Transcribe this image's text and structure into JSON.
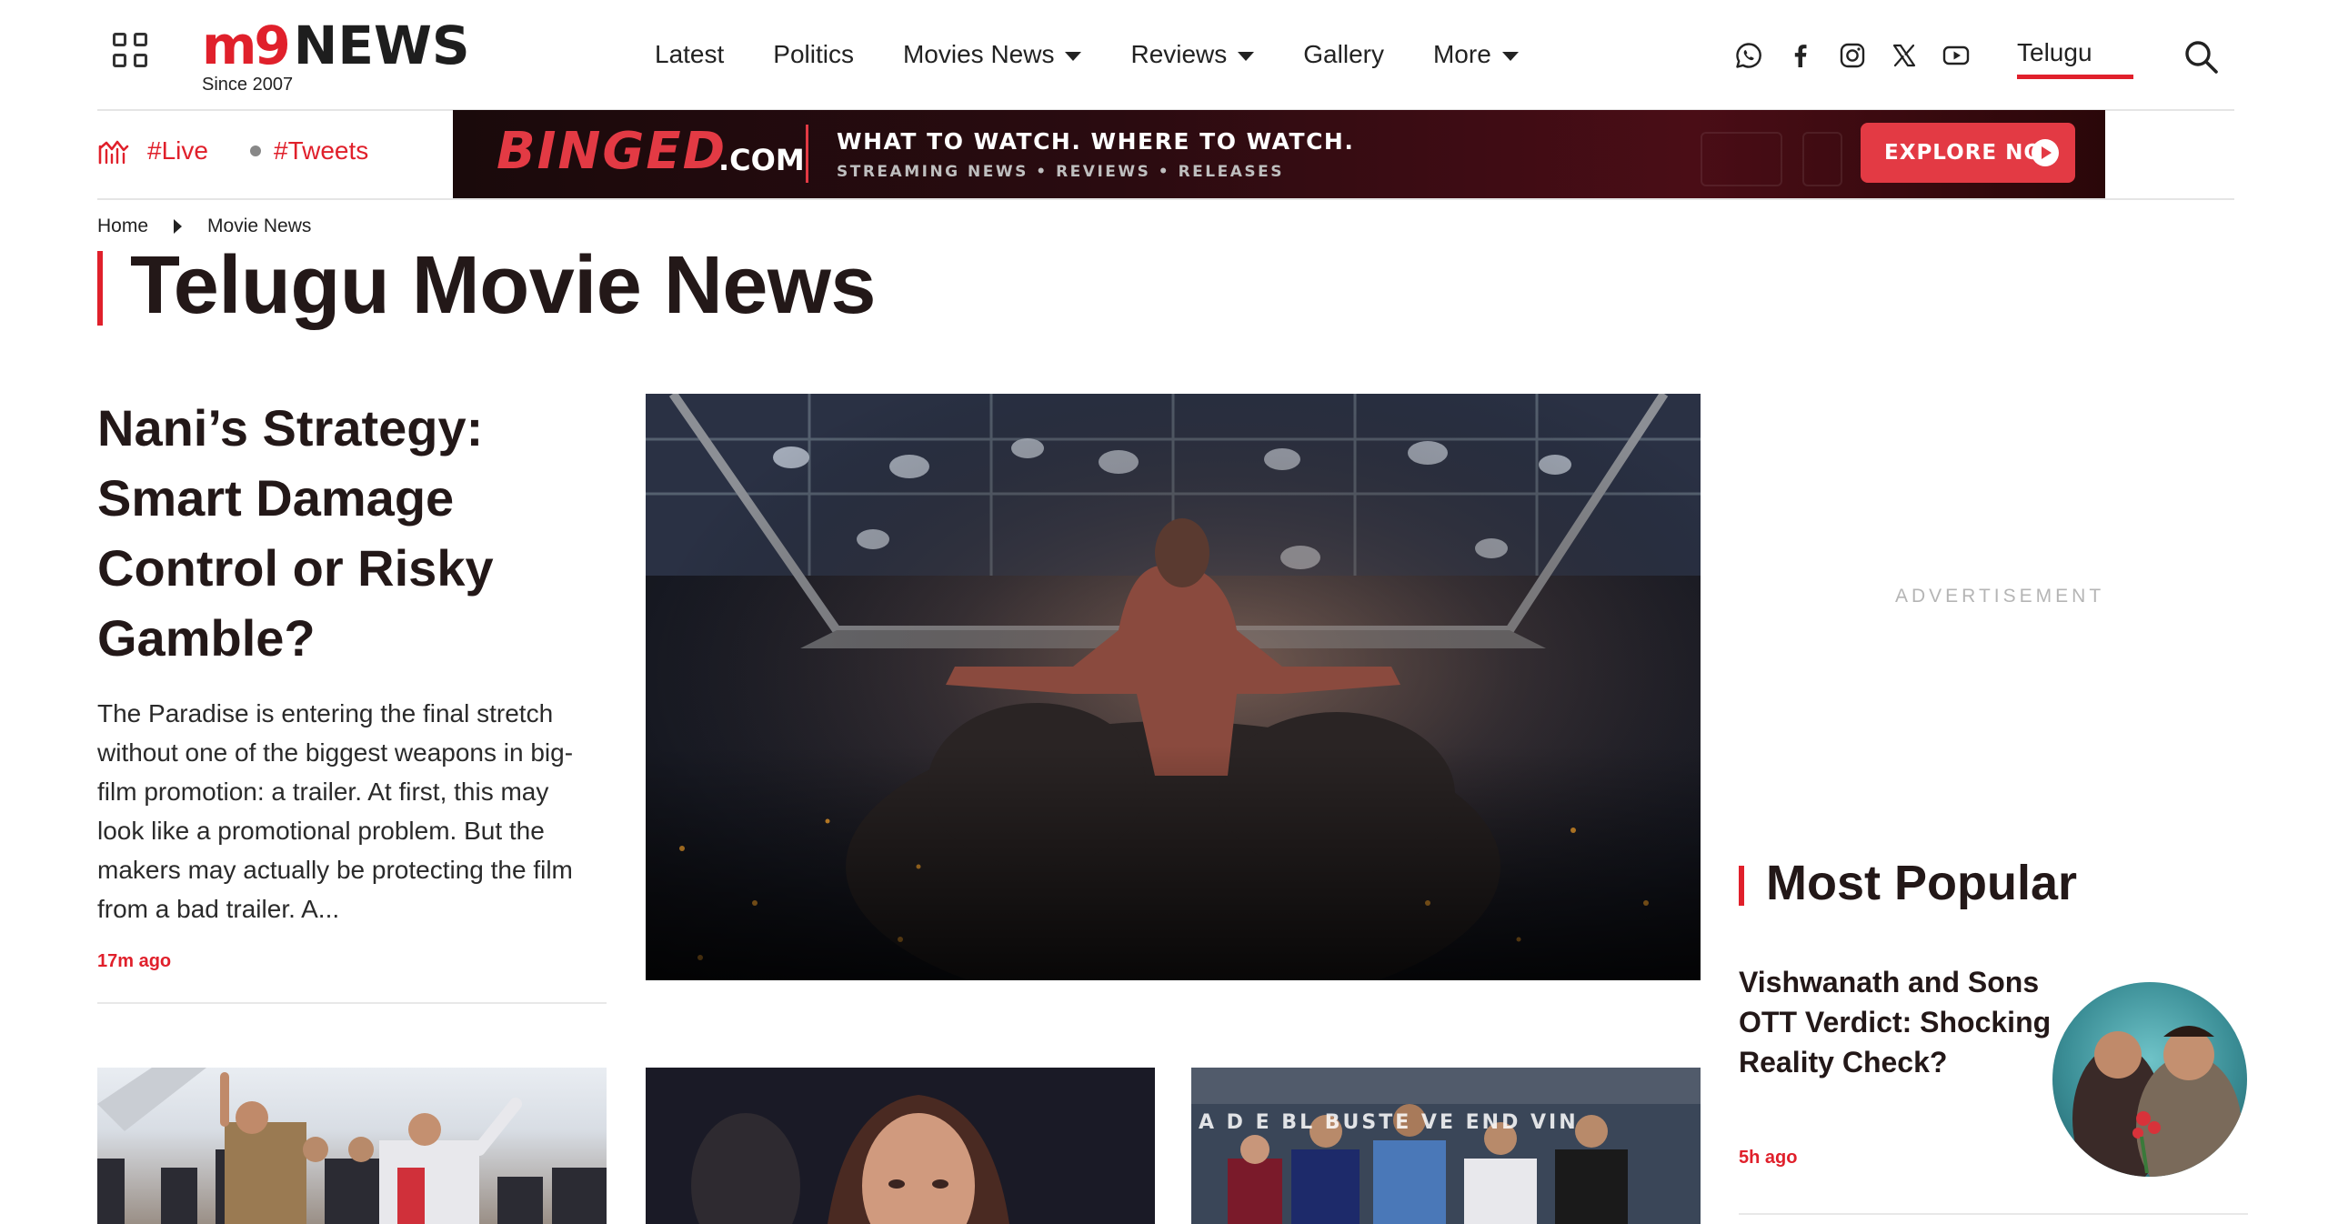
{
  "header": {
    "apps_icon": "grid-icon",
    "logo": {
      "mark": "m9",
      "word": "NEWS",
      "since": "Since 2007"
    },
    "nav": [
      {
        "label": "Latest",
        "dropdown": false
      },
      {
        "label": "Politics",
        "dropdown": false
      },
      {
        "label": "Movies News",
        "dropdown": true
      },
      {
        "label": "Reviews",
        "dropdown": true
      },
      {
        "label": "Gallery",
        "dropdown": false
      },
      {
        "label": "More",
        "dropdown": true
      }
    ],
    "social_icons": [
      "whatsapp-icon",
      "facebook-icon",
      "instagram-icon",
      "x-icon",
      "youtube-icon"
    ],
    "language": "Telugu",
    "search_icon": "search-icon"
  },
  "subbar": {
    "live": "#Live",
    "tweets": "#Tweets",
    "banner": {
      "brand": "BINGED",
      "domain": ".COM",
      "tagline": "WHAT TO WATCH. WHERE TO WATCH.",
      "subline": "STREAMING NEWS • REVIEWS • RELEASES",
      "cta": "EXPLORE NO"
    }
  },
  "breadcrumb": [
    "Home",
    "Movie News"
  ],
  "page_title": "Telugu Movie News",
  "lead": {
    "headline": "Nani’s Strategy: Smart Damage Control or Risky Gamble?",
    "excerpt": "The Paradise is entering the final stretch without one of the biggest weapons in big-film promotion: a trailer. At first, this may look like a promotional problem. But the makers may actually be protecting the film from a bad trailer. A...",
    "time": "17m ago"
  },
  "sidebar": {
    "ad_label": "ADVERTISEMENT",
    "popular_title": "Most Popular",
    "popular": [
      {
        "headline": "Vishwanath and Sons OTT Verdict: Shocking Reality Check?",
        "time": "5h ago"
      }
    ]
  },
  "thumbs": {
    "third_caption": "A D  E  BL  BUSTE  VE  END  VIN"
  },
  "colors": {
    "accent": "#e0202b",
    "text": "#231818",
    "banner_bg": "#2a0b10",
    "banner_red": "#e33a44"
  }
}
